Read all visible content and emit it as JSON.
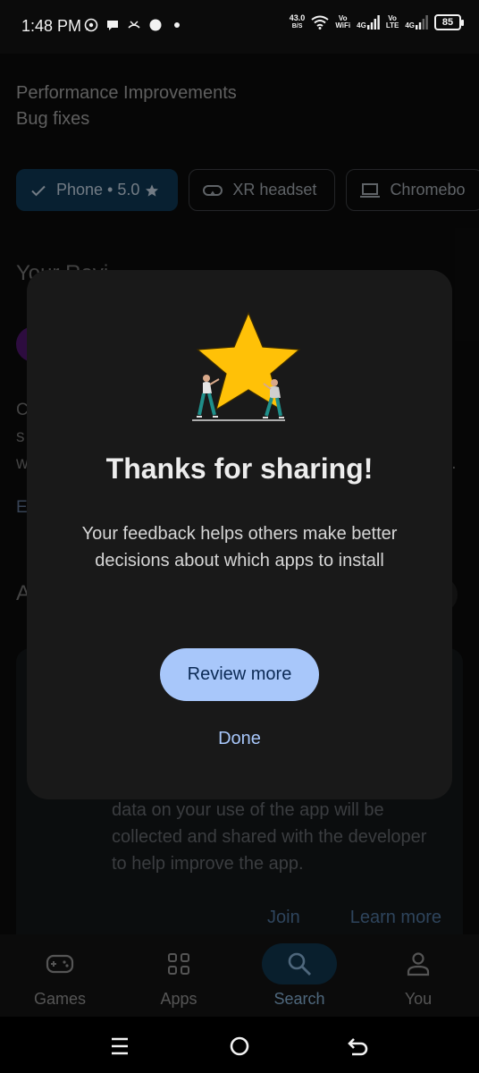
{
  "status_bar": {
    "time": "1:48 PM",
    "net_speed_value": "43.0",
    "net_speed_unit": "B/S",
    "vowifi_top": "Vo",
    "vowifi_bottom": "WiFi",
    "sim1": "4G",
    "volte_top": "Vo",
    "volte_bottom": "LTE",
    "sim2": "4G",
    "battery": "85",
    "left_icons": [
      "whatsapp-icon",
      "chat-icon",
      "missed-call-icon",
      "circle-notification-icon",
      "dot-icon"
    ]
  },
  "background": {
    "whats_new": [
      "Performance Improvements",
      "Bug fixes"
    ],
    "chips": [
      {
        "label": "Phone • 5.0",
        "icon": "check-icon",
        "trail_icon": "star-icon",
        "selected": true
      },
      {
        "label": "XR headset",
        "icon": "vr-headset-icon",
        "selected": false
      },
      {
        "label": "Chromebo",
        "icon": "laptop-icon",
        "selected": false
      }
    ],
    "section_fragment": "Your Revi",
    "left_fragments": [
      "C",
      "s",
      "w",
      "E",
      "A"
    ],
    "ellipsis": "..",
    "program_text": "data on your use of the app will be collected and shared with the developer to help improve the app.",
    "program_join": "Join",
    "program_learn_more": "Learn more"
  },
  "dialog": {
    "title": "Thanks for sharing!",
    "body": "Your feedback helps others make better decisions about which apps to install",
    "primary_button": "Review more",
    "secondary_button": "Done",
    "illustration": "star-carried-by-people-illustration"
  },
  "bottom_nav": {
    "items": [
      {
        "label": "Games",
        "icon": "gamepad-icon",
        "active": false
      },
      {
        "label": "Apps",
        "icon": "apps-grid-icon",
        "active": false
      },
      {
        "label": "Search",
        "icon": "search-icon",
        "active": true
      },
      {
        "label": "You",
        "icon": "person-icon",
        "active": false
      }
    ]
  },
  "system_nav": {
    "buttons": [
      "menu-icon",
      "home-icon",
      "back-icon"
    ]
  },
  "colors": {
    "dialog_bg": "#191919",
    "primary_button_bg": "#a8c7fa",
    "primary_button_text": "#0b2a55",
    "link": "#a8c7fa",
    "star": "#ffc107"
  }
}
